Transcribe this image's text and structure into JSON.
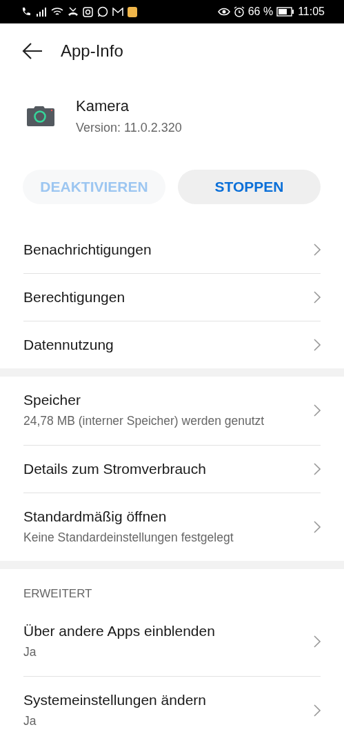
{
  "status_bar": {
    "battery": "66 %",
    "time": "11:05"
  },
  "header": {
    "title": "App-Info"
  },
  "app": {
    "name": "Kamera",
    "version": "Version: 11.0.2.320"
  },
  "buttons": [
    {
      "label": "DEAKTIVIEREN",
      "disabled": true
    },
    {
      "label": "STOPPEN",
      "disabled": false
    }
  ],
  "groups": [
    {
      "items": [
        {
          "title": "Benachrichtigungen"
        },
        {
          "title": "Berechtigungen"
        },
        {
          "title": "Datennutzung"
        }
      ]
    },
    {
      "items": [
        {
          "title": "Speicher",
          "subtitle": "24,78 MB (interner Speicher) werden genutzt"
        },
        {
          "title": "Details zum Stromverbrauch"
        },
        {
          "title": "Standardmäßig öffnen",
          "subtitle": "Keine Standardeinstellungen festgelegt"
        }
      ]
    },
    {
      "header": "ERWEITERT",
      "items": [
        {
          "title": "Über andere Apps einblenden",
          "subtitle": "Ja"
        },
        {
          "title": "Systemeinstellungen ändern",
          "subtitle": "Ja"
        }
      ]
    }
  ]
}
